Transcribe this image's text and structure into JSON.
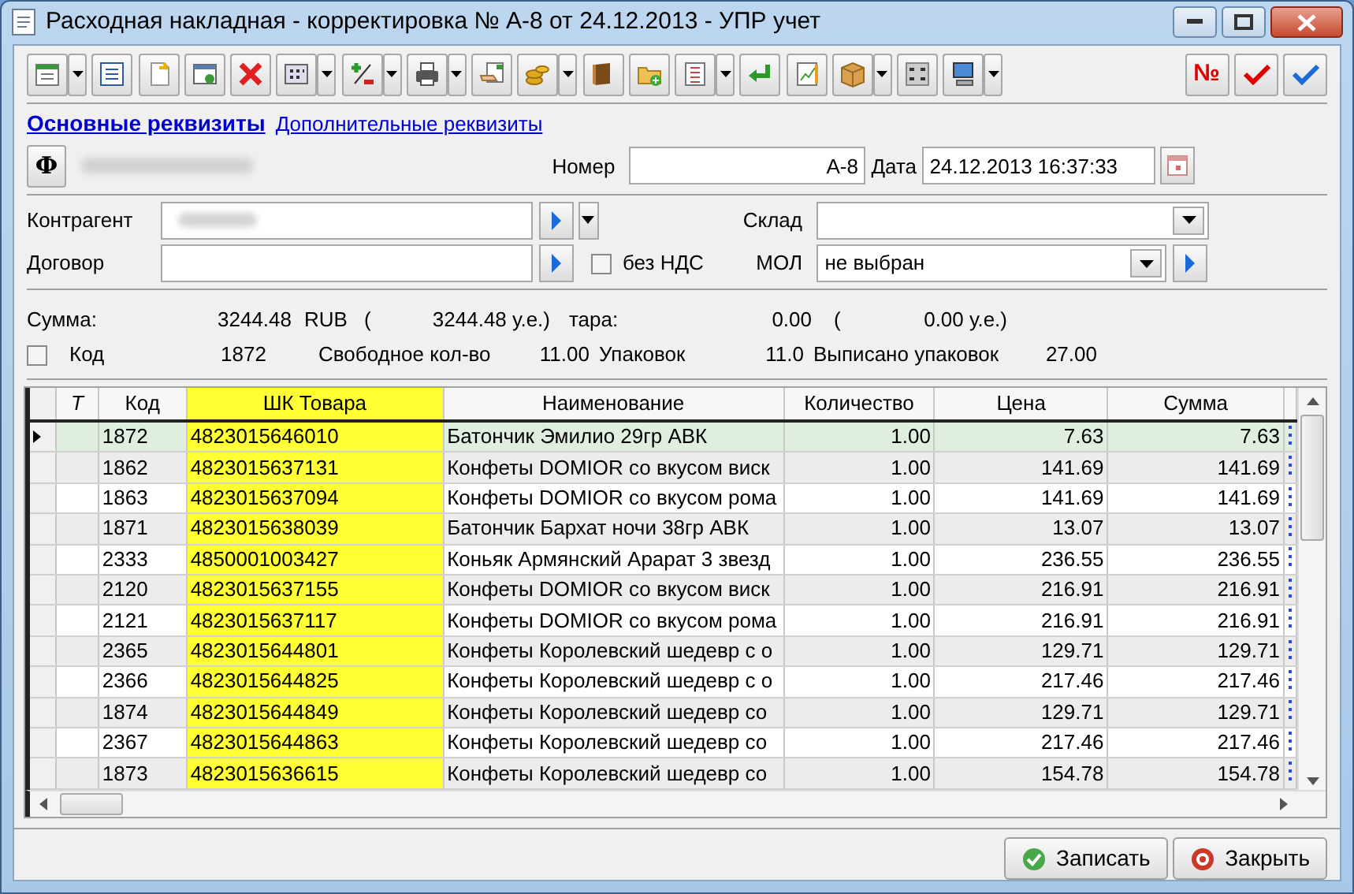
{
  "window": {
    "title": "Расходная накладная - корректировка № А-8 от 24.12.2013 - УПР учет"
  },
  "toolbar": {
    "buttons": [
      {
        "dropdown": true
      },
      {
        "dropdown": false
      },
      {
        "dropdown": false
      },
      {
        "dropdown": false
      },
      {
        "dropdown": false
      },
      {
        "dropdown": true
      },
      {
        "dropdown": true
      },
      {
        "dropdown": true
      },
      {
        "dropdown": false
      },
      {
        "dropdown": true
      },
      {
        "dropdown": false
      },
      {
        "dropdown": false
      },
      {
        "dropdown": true
      },
      {
        "dropdown": false
      },
      {
        "dropdown": false
      },
      {
        "dropdown": true
      },
      {
        "dropdown": false
      },
      {
        "dropdown": true
      }
    ],
    "number_button": {
      "label": "№"
    }
  },
  "tabs": [
    {
      "label": "Основные реквизиты",
      "selected": true
    },
    {
      "label": "Дополнительные реквизиты",
      "selected": false
    }
  ],
  "header": {
    "org_button": "Ф",
    "number_label": "Номер",
    "number": "А-8",
    "date_label": "Дата",
    "date": "24.12.2013 16:37:33"
  },
  "fields": {
    "counterparty_label": "Контрагент",
    "contract_label": "Договор",
    "no_vat": {
      "label": "без НДС",
      "checked": false
    },
    "warehouse_label": "Склад",
    "mol_label": "МОЛ",
    "mol": "не выбран"
  },
  "totals": {
    "sum_label": "Сумма:",
    "sum": "3244.48",
    "currency": "RUB",
    "open_paren": "(",
    "sum_ue": "3244.48 у.е.)",
    "tare_label": "тара:",
    "tare": "0.00",
    "tare_open_paren": "(",
    "tare_ue": "0.00 у.е.)"
  },
  "item_info": {
    "checked": false,
    "code_label": "Код",
    "code": "1872",
    "free_label": "Свободное кол-во",
    "free": "11.00",
    "packs_label": "Упаковок",
    "packs": "11.0",
    "written_label": "Выписано упаковок",
    "written": "27.00"
  },
  "table": {
    "columns": [
      {
        "label": "T",
        "highlighted": false
      },
      {
        "label": "Код",
        "highlighted": false
      },
      {
        "label": "ШК Товара",
        "highlighted": true
      },
      {
        "label": "Наименование",
        "highlighted": false
      },
      {
        "label": "Количество",
        "highlighted": false
      },
      {
        "label": "Цена",
        "highlighted": false
      },
      {
        "label": "Сумма",
        "highlighted": false
      }
    ],
    "rows": [
      {
        "selected": true,
        "cells": [
          "",
          "1872",
          "4823015646010",
          "Батончик Эмилио 29гр АВК",
          "1.00",
          "7.63",
          "7.63"
        ]
      },
      {
        "selected": false,
        "cells": [
          "",
          "1862",
          "4823015637131",
          "Конфеты DOMIOR со вкусом виск",
          "1.00",
          "141.69",
          "141.69"
        ]
      },
      {
        "selected": false,
        "cells": [
          "",
          "1863",
          "4823015637094",
          "Конфеты DOMIOR со вкусом рома",
          "1.00",
          "141.69",
          "141.69"
        ]
      },
      {
        "selected": false,
        "cells": [
          "",
          "1871",
          "4823015638039",
          "Батончик Бархат ночи 38гр АВК",
          "1.00",
          "13.07",
          "13.07"
        ]
      },
      {
        "selected": false,
        "cells": [
          "",
          "2333",
          "4850001003427",
          "Коньяк Армянский Арарат 3 звезд",
          "1.00",
          "236.55",
          "236.55"
        ]
      },
      {
        "selected": false,
        "cells": [
          "",
          "2120",
          "4823015637155",
          "Конфеты DOMIOR со вкусом виск",
          "1.00",
          "216.91",
          "216.91"
        ]
      },
      {
        "selected": false,
        "cells": [
          "",
          "2121",
          "4823015637117",
          "Конфеты DOMIOR со вкусом рома",
          "1.00",
          "216.91",
          "216.91"
        ]
      },
      {
        "selected": false,
        "cells": [
          "",
          "2365",
          "4823015644801",
          "Конфеты Королевский шедевр с о",
          "1.00",
          "129.71",
          "129.71"
        ]
      },
      {
        "selected": false,
        "cells": [
          "",
          "2366",
          "4823015644825",
          "Конфеты Королевский шедевр с о",
          "1.00",
          "217.46",
          "217.46"
        ]
      },
      {
        "selected": false,
        "cells": [
          "",
          "1874",
          "4823015644849",
          "Конфеты Королевский шедевр со",
          "1.00",
          "129.71",
          "129.71"
        ]
      },
      {
        "selected": false,
        "cells": [
          "",
          "2367",
          "4823015644863",
          "Конфеты Королевский шедевр со",
          "1.00",
          "217.46",
          "217.46"
        ]
      },
      {
        "selected": false,
        "cells": [
          "",
          "1873",
          "4823015636615",
          "Конфеты Королевский шедевр со",
          "1.00",
          "154.78",
          "154.78"
        ]
      }
    ]
  },
  "buttons": [
    {
      "kind": "save",
      "label": "Записать"
    },
    {
      "kind": "close",
      "label": "Закрыть"
    }
  ]
}
